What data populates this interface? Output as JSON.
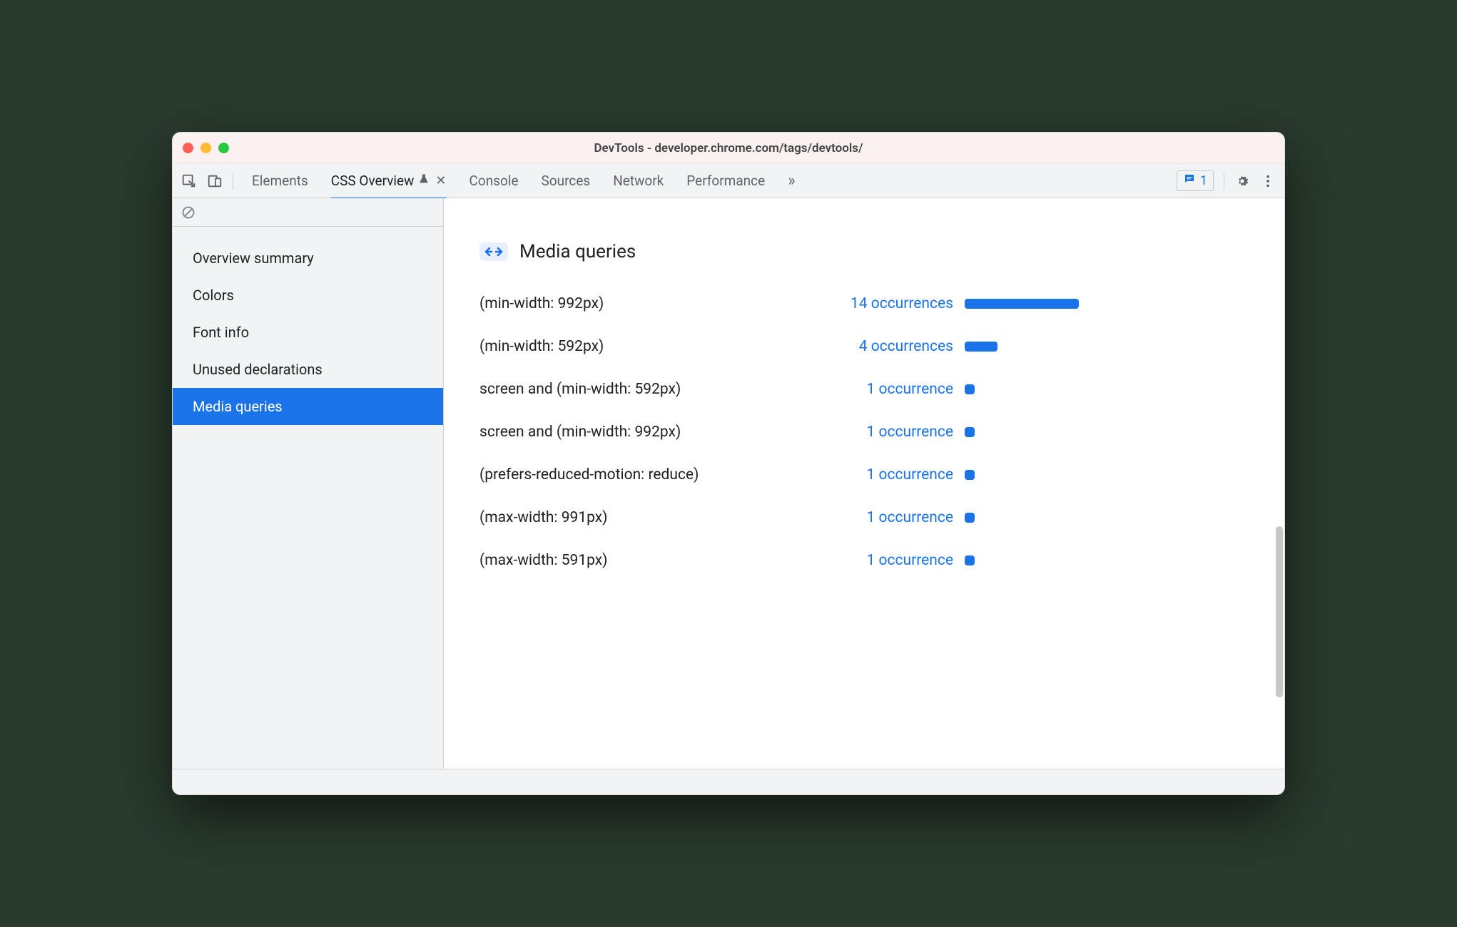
{
  "window": {
    "title": "DevTools - developer.chrome.com/tags/devtools/"
  },
  "toolbar": {
    "tabs": [
      {
        "label": "Elements",
        "active": false
      },
      {
        "label": "CSS Overview",
        "active": true,
        "experimental": true,
        "closable": true
      },
      {
        "label": "Console",
        "active": false
      },
      {
        "label": "Sources",
        "active": false
      },
      {
        "label": "Network",
        "active": false
      },
      {
        "label": "Performance",
        "active": false
      }
    ],
    "issues_count": "1"
  },
  "sidebar": {
    "items": [
      {
        "label": "Overview summary",
        "active": false
      },
      {
        "label": "Colors",
        "active": false
      },
      {
        "label": "Font info",
        "active": false
      },
      {
        "label": "Unused declarations",
        "active": false
      },
      {
        "label": "Media queries",
        "active": true
      }
    ]
  },
  "main": {
    "heading": "Media queries",
    "rows": [
      {
        "query": "(min-width: 992px)",
        "count_label": "14 occurrences",
        "count": 14
      },
      {
        "query": "(min-width: 592px)",
        "count_label": "4 occurrences",
        "count": 4
      },
      {
        "query": "screen and (min-width: 592px)",
        "count_label": "1 occurrence",
        "count": 1
      },
      {
        "query": "screen and (min-width: 992px)",
        "count_label": "1 occurrence",
        "count": 1
      },
      {
        "query": "(prefers-reduced-motion: reduce)",
        "count_label": "1 occurrence",
        "count": 1
      },
      {
        "query": "(max-width: 991px)",
        "count_label": "1 occurrence",
        "count": 1
      },
      {
        "query": "(max-width: 591px)",
        "count_label": "1 occurrence",
        "count": 1
      }
    ]
  },
  "colors": {
    "accent": "#1a73e8"
  },
  "chart_data": {
    "type": "bar",
    "categories": [
      "(min-width: 992px)",
      "(min-width: 592px)",
      "screen and (min-width: 592px)",
      "screen and (min-width: 992px)",
      "(prefers-reduced-motion: reduce)",
      "(max-width: 991px)",
      "(max-width: 591px)"
    ],
    "values": [
      14,
      4,
      1,
      1,
      1,
      1,
      1
    ],
    "title": "Media queries",
    "xlabel": "occurrences",
    "ylabel": "media query",
    "xlim": [
      0,
      14
    ]
  }
}
